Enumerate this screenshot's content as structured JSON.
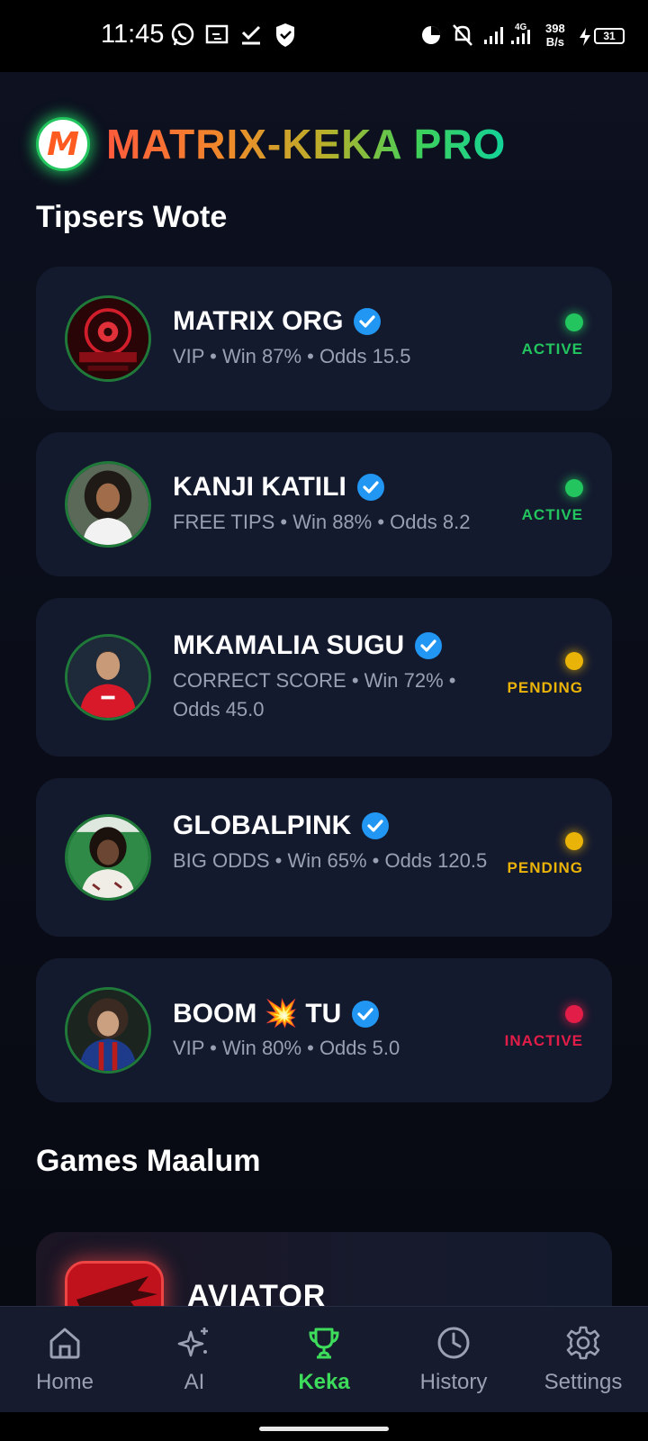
{
  "status_bar": {
    "time": "11:45",
    "net_speed_value": "398",
    "net_speed_unit": "B/s",
    "network_type": "4G",
    "battery": "31"
  },
  "app": {
    "brand_initial": "M",
    "title": "MATRIX-KEKA PRO"
  },
  "tipsters": {
    "section_title": "Tipsers Wote",
    "items": [
      {
        "name": "MATRIX ORG",
        "subtitle": "VIP • Win 87% • Odds 15.5",
        "status": "ACTIVE",
        "status_color": "#22c55e",
        "avatar": "matrix-logo-avatar"
      },
      {
        "name": "KANJI KATILI",
        "subtitle": "FREE TIPS • Win 88% • Odds 8.2",
        "status": "ACTIVE",
        "status_color": "#22c55e",
        "avatar": "person-avatar"
      },
      {
        "name": "MKAMALIA SUGU",
        "subtitle": "CORRECT SCORE • Win 72% • Odds 45.0",
        "status": "PENDING",
        "status_color": "#eab308",
        "avatar": "football-player-avatar"
      },
      {
        "name": "GLOBALPINK",
        "subtitle": "BIG ODDS • Win 65% • Odds 120.5",
        "status": "PENDING",
        "status_color": "#eab308",
        "avatar": "person-avatar"
      },
      {
        "name": "BOOM 💥 TU",
        "subtitle": "VIP • Win 80% • Odds 5.0",
        "status": "INACTIVE",
        "status_color": "#e11d48",
        "avatar": "football-player-avatar"
      }
    ]
  },
  "games": {
    "section_title": "Games Maalum",
    "items": [
      {
        "title": "AVIATOR",
        "icon": "airplane-icon"
      }
    ]
  },
  "bottom_nav": {
    "items": [
      {
        "label": "Home",
        "icon": "home-icon",
        "active": false
      },
      {
        "label": "AI",
        "icon": "sparkles-icon",
        "active": false
      },
      {
        "label": "Keka",
        "icon": "trophy-icon",
        "active": true
      },
      {
        "label": "History",
        "icon": "clock-icon",
        "active": false
      },
      {
        "label": "Settings",
        "icon": "gear-icon",
        "active": false
      }
    ]
  },
  "colors": {
    "accent_green": "#3ddc5a",
    "background": "#0d1120",
    "card": "#141a2e",
    "verified_blue": "#2196f3"
  }
}
